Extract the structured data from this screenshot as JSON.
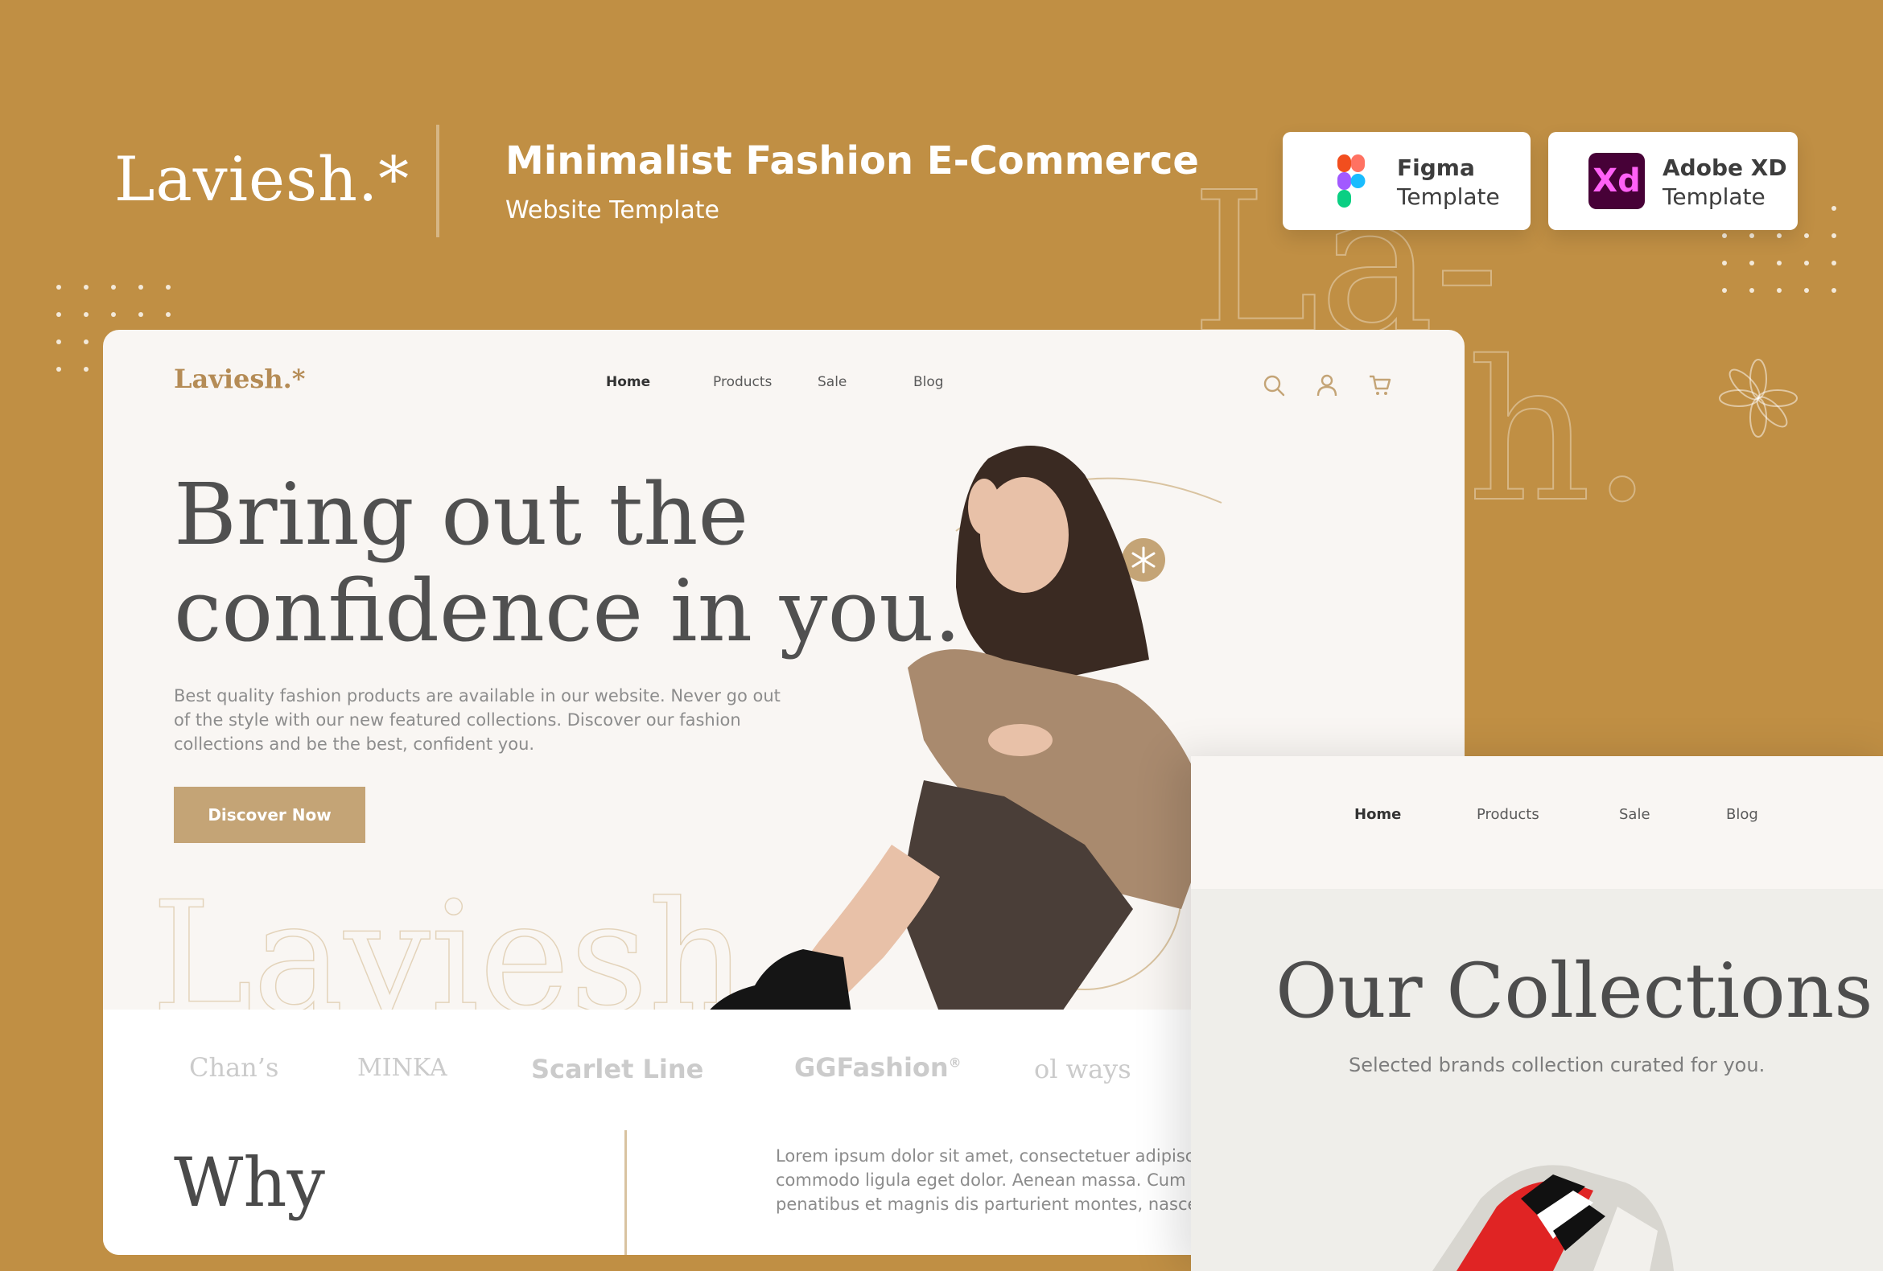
{
  "promo": {
    "brand": "Laviesh.*",
    "title": "Minimalist Fashion E-Commerce",
    "subtitle": "Website Template",
    "badges": [
      {
        "icon": "figma-logo-icon",
        "name": "Figma",
        "sub": "Template"
      },
      {
        "icon": "adobe-xd-logo-icon",
        "name": "Adobe XD",
        "sub": "Template",
        "glyph": "Xd"
      }
    ],
    "watermark_text": "Laviesh.*"
  },
  "site": {
    "logo": "Laviesh.*",
    "nav": [
      "Home",
      "Products",
      "Sale",
      "Blog"
    ],
    "active_nav": "Home",
    "icons": [
      "search-icon",
      "user-icon",
      "cart-icon"
    ],
    "hero": {
      "heading_line1": "Bring out the",
      "heading_line2": "confidence in you.",
      "description": "Best quality fashion products are available in our website. Never go out of the style with our new featured collections. Discover our fashion collections and be the best, confident you.",
      "cta": "Discover Now",
      "watermark": "Laviesh"
    },
    "brands": [
      "Chan’s",
      "MINKA",
      "Scarlet Line",
      "GGFashion",
      "ol ways"
    ],
    "brand_mark": "®",
    "why": {
      "heading": "Why",
      "body_line1": "Lorem ipsum dolor sit amet, consectetuer adipisc",
      "body_line2": "commodo ligula eget dolor. Aenean massa. Cum",
      "body_line3": "penatibus et magnis dis parturient montes, nasce"
    }
  },
  "second": {
    "nav": [
      "Home",
      "Products",
      "Sale",
      "Blog"
    ],
    "title": "Our Collections",
    "subtitle": "Selected brands collection curated for you."
  },
  "colors": {
    "background": "#C08F44",
    "card": "#F9F6F3",
    "accent": "#C4A476",
    "text_dark": "#505050"
  }
}
